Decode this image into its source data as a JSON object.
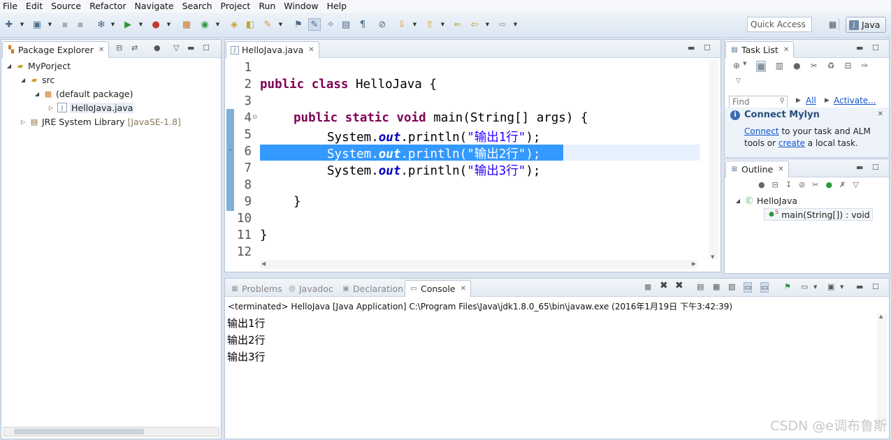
{
  "menubar": [
    "File",
    "Edit",
    "Source",
    "Refactor",
    "Navigate",
    "Search",
    "Project",
    "Run",
    "Window",
    "Help"
  ],
  "toolbar": {
    "quick_access_placeholder": "Quick Access",
    "perspective_label": "Java"
  },
  "package_explorer": {
    "tab_label": "Package Explorer",
    "tree": {
      "project": "MyPorject",
      "src": "src",
      "package": "(default package)",
      "file": "HelloJava.java",
      "jre_label": "JRE System Library",
      "jre_version": "[JavaSE-1.8]"
    }
  },
  "editor": {
    "tab_label": "HelloJava.java",
    "line_numbers": [
      "1",
      "2",
      "3",
      "4",
      "5",
      "6",
      "7",
      "8",
      "9",
      "10",
      "11",
      "12"
    ],
    "code": {
      "l2_kw": "public class",
      "l2_rest": " HelloJava {",
      "l4_kw": "public static void",
      "l4_rest": " main(String[] args) {",
      "call_prefix": "System.",
      "call_field": "out",
      "call_method": ".println(",
      "str1": "\"输出1行\"",
      "str2": "\"输出2行\"",
      "str3": "\"输出3行\"",
      "call_end": ");",
      "brace_method": "}",
      "brace_class": "}"
    }
  },
  "task_list": {
    "tab_label": "Task List",
    "find_placeholder": "Find",
    "filter_all": "All",
    "filter_activate": "Activate...",
    "mylyn_title": "Connect Mylyn",
    "mylyn_link1": "Connect",
    "mylyn_text1": " to your task and ALM",
    "mylyn_text2": "tools or ",
    "mylyn_link2": "create",
    "mylyn_text3": " a local task."
  },
  "outline": {
    "tab_label": "Outline",
    "class_name": "HelloJava",
    "method_sig": "main(String[]) : void"
  },
  "bottom_panel": {
    "tabs": {
      "problems": "Problems",
      "javadoc": "Javadoc",
      "declaration": "Declaration",
      "console": "Console"
    },
    "status": "<terminated> HelloJava [Java Application] C:\\Program Files\\Java\\jdk1.8.0_65\\bin\\javaw.exe (2016年1月19日 下午3:42:39)",
    "output": [
      "输出1行",
      "输出2行",
      "输出3行"
    ]
  },
  "watermark": "CSDN @e调布鲁斯",
  "colors": {
    "keyword": "#7f0055",
    "string": "#2a00ff",
    "field": "#0000c0",
    "selection": "#3399ff"
  }
}
